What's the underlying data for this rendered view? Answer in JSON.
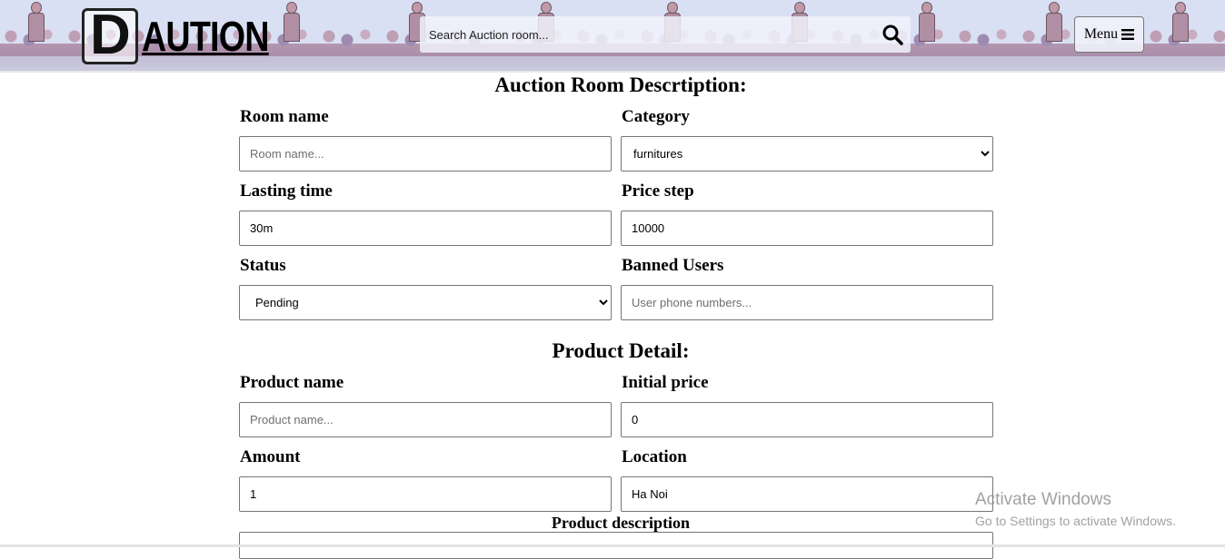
{
  "header": {
    "logo_letter": "D",
    "logo_text": "AUTION",
    "search_placeholder": "Search Auction room...",
    "menu_label": "Menu"
  },
  "room_section": {
    "title": "Auction Room Descrtiption:",
    "room_name": {
      "label": "Room name",
      "placeholder": "Room name...",
      "value": ""
    },
    "category": {
      "label": "Category",
      "value": "furnitures"
    },
    "lasting_time": {
      "label": "Lasting time",
      "value": "30m"
    },
    "price_step": {
      "label": "Price step",
      "value": "10000"
    },
    "status": {
      "label": "Status",
      "value": "Pending"
    },
    "banned_users": {
      "label": "Banned Users",
      "placeholder": "User phone numbers...",
      "value": ""
    }
  },
  "product_section": {
    "title": "Product Detail:",
    "product_name": {
      "label": "Product name",
      "placeholder": "Product name...",
      "value": ""
    },
    "initial_price": {
      "label": "Initial price",
      "value": "0"
    },
    "amount": {
      "label": "Amount",
      "value": "1"
    },
    "location": {
      "label": "Location",
      "value": "Ha Noi"
    },
    "description": {
      "label": "Product description"
    }
  },
  "watermark": {
    "line1": "Activate Windows",
    "line2": "Go to Settings to activate Windows."
  }
}
